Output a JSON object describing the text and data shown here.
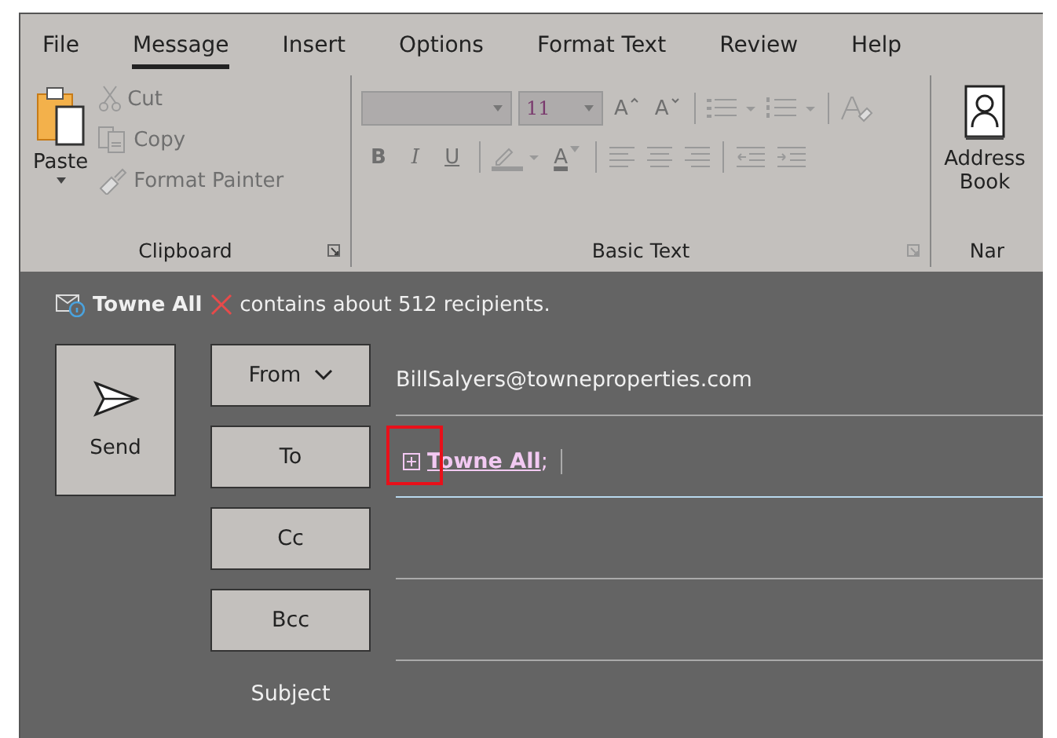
{
  "tabs": [
    {
      "label": "File",
      "selected": false
    },
    {
      "label": "Message",
      "selected": true
    },
    {
      "label": "Insert",
      "selected": false
    },
    {
      "label": "Options",
      "selected": false
    },
    {
      "label": "Format Text",
      "selected": false
    },
    {
      "label": "Review",
      "selected": false
    },
    {
      "label": "Help",
      "selected": false
    }
  ],
  "clipboard": {
    "label": "Clipboard",
    "paste": "Paste",
    "commands": [
      {
        "label": "Cut",
        "disabled": true
      },
      {
        "label": "Copy",
        "disabled": true
      },
      {
        "label": "Format Painter",
        "disabled": true
      }
    ]
  },
  "basic_text": {
    "label": "Basic Text",
    "disabled": true,
    "font_size": "11",
    "grow_font": "A",
    "shrink_font": "A",
    "style_buttons": [
      "B",
      "I",
      "U"
    ],
    "font_color": "A"
  },
  "names": {
    "label": "Nar",
    "address_book": "Address Book"
  },
  "infobar": {
    "name": "Towne All",
    "message": "contains about 512 recipients."
  },
  "from": {
    "button": "From",
    "address": "BillSalyers@towneproperties.com"
  },
  "to": {
    "button": "To",
    "recipient": "Towne All",
    "separator": ";",
    "highlighted": true
  },
  "cc": {
    "button": "Cc"
  },
  "bcc": {
    "button": "Bcc"
  },
  "subject": {
    "label": "Subject"
  },
  "send": {
    "label": "Send"
  }
}
